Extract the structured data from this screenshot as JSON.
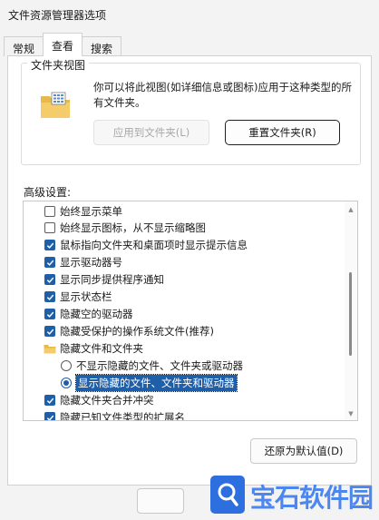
{
  "window": {
    "title": "文件资源管理器选项"
  },
  "tabs": [
    {
      "label": "常规",
      "active": false
    },
    {
      "label": "查看",
      "active": true
    },
    {
      "label": "搜索",
      "active": false
    }
  ],
  "folder_views": {
    "title": "文件夹视图",
    "description": "你可以将此视图(如详细信息或图标)应用于这种类型的所有文件夹。",
    "apply_button": "应用到文件夹(L)",
    "reset_button": "重置文件夹(R)"
  },
  "advanced": {
    "label": "高级设置:",
    "items": [
      {
        "type": "checkbox",
        "checked": false,
        "label": "始终显示菜单"
      },
      {
        "type": "checkbox",
        "checked": false,
        "label": "始终显示图标，从不显示缩略图"
      },
      {
        "type": "checkbox",
        "checked": true,
        "label": "鼠标指向文件夹和桌面项时显示提示信息"
      },
      {
        "type": "checkbox",
        "checked": true,
        "label": "显示驱动器号"
      },
      {
        "type": "checkbox",
        "checked": true,
        "label": "显示同步提供程序通知"
      },
      {
        "type": "checkbox",
        "checked": true,
        "label": "显示状态栏"
      },
      {
        "type": "checkbox",
        "checked": true,
        "label": "隐藏空的驱动器"
      },
      {
        "type": "checkbox",
        "checked": true,
        "label": "隐藏受保护的操作系统文件(推荐)"
      },
      {
        "type": "folder",
        "label": "隐藏文件和文件夹"
      },
      {
        "type": "radio",
        "checked": false,
        "label": "不显示隐藏的文件、文件夹或驱动器"
      },
      {
        "type": "radio",
        "checked": true,
        "selected": true,
        "label": "显示隐藏的文件、文件夹和驱动器"
      },
      {
        "type": "checkbox",
        "checked": true,
        "label": "隐藏文件夹合并冲突"
      },
      {
        "type": "checkbox",
        "checked": true,
        "label": "隐藏已知文件类型的扩展名"
      }
    ],
    "restore_button": "还原为默认值(D)"
  },
  "watermark": {
    "text": "宝石软件园"
  },
  "colors": {
    "accent": "#1f5ea9",
    "background": "#f3f3f3",
    "panel": "#ffffff"
  },
  "icons": [
    "folder-view-icon",
    "checkbox-icon",
    "radio-icon",
    "folder-icon",
    "scroll-up-icon",
    "scroll-down-icon",
    "watermark-logo-icon"
  ]
}
